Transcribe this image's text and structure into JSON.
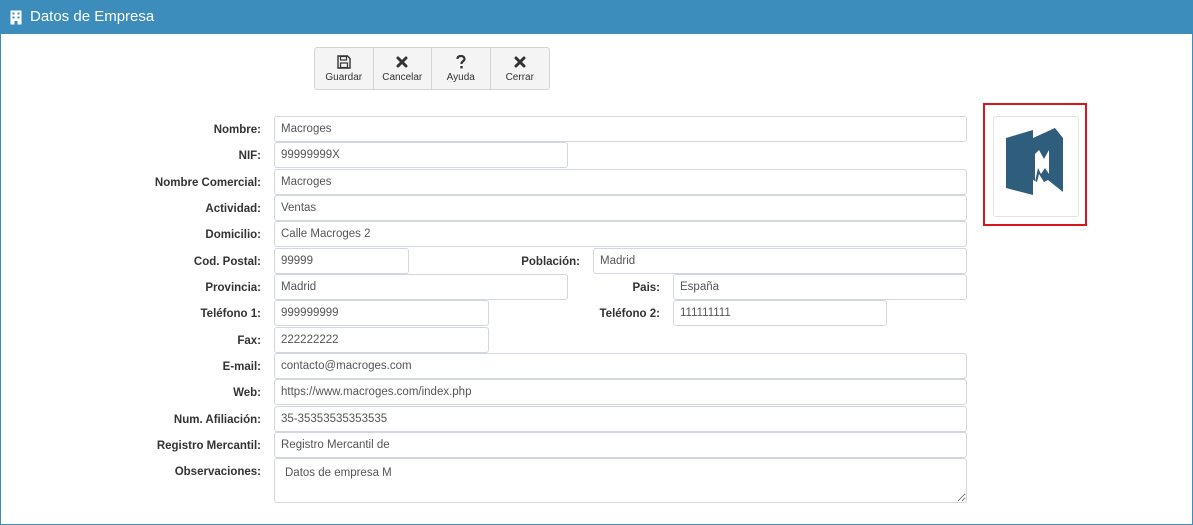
{
  "header": {
    "title": "Datos de Empresa",
    "icon": "building-icon"
  },
  "toolbar": {
    "save_label": "Guardar",
    "cancel_label": "Cancelar",
    "help_label": "Ayuda",
    "close_label": "Cerrar"
  },
  "form": {
    "nombre": {
      "label": "Nombre:",
      "value": "Macroges"
    },
    "nif": {
      "label": "NIF:",
      "value": "99999999X"
    },
    "nombre_comercial": {
      "label": "Nombre Comercial:",
      "value": "Macroges"
    },
    "actividad": {
      "label": "Actividad:",
      "value": "Ventas"
    },
    "domicilio": {
      "label": "Domicilio:",
      "value": "Calle Macroges 2"
    },
    "cod_postal": {
      "label": "Cod. Postal:",
      "value": "99999"
    },
    "poblacion": {
      "label": "Población:",
      "value": "Madrid"
    },
    "provincia": {
      "label": "Provincia:",
      "value": "Madrid"
    },
    "pais": {
      "label": "Pais:",
      "value": "España"
    },
    "telefono1": {
      "label": "Teléfono 1:",
      "value": "999999999"
    },
    "telefono2": {
      "label": "Teléfono 2:",
      "value": "111111111"
    },
    "fax": {
      "label": "Fax:",
      "value": "222222222"
    },
    "email": {
      "label": "E-mail:",
      "value": "contacto@macroges.com"
    },
    "web": {
      "label": "Web:",
      "value": "https://www.macroges.com/index.php"
    },
    "num_afiliacion": {
      "label": "Num. Afiliación:",
      "value": "35-35353535353535"
    },
    "registro_mercantil": {
      "label": "Registro Mercantil:",
      "value": "Registro Mercantil de"
    },
    "observaciones": {
      "label": "Observaciones:",
      "value": "Datos de empresa M"
    }
  },
  "logo": {
    "icon": "macroges-logo",
    "highlight_color": "#d9161c"
  },
  "colors": {
    "header": "#3c8dbc",
    "logo": "#2f5d7c"
  }
}
